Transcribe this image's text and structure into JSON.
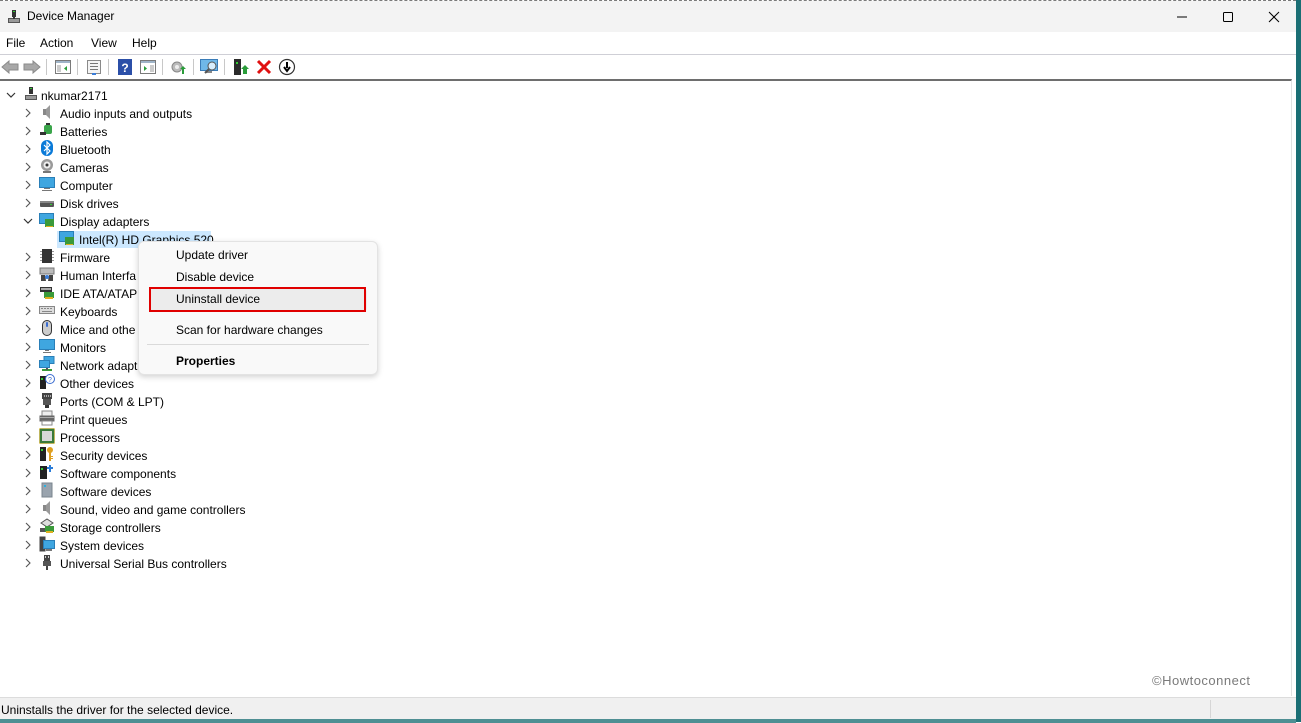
{
  "window": {
    "title": "Device Manager",
    "controls": {
      "minimize": "minimize",
      "maximize": "maximize",
      "close": "close"
    },
    "accent_edge_color": "#1a6e74"
  },
  "menubar": {
    "items": [
      {
        "label": "File"
      },
      {
        "label": "Action"
      },
      {
        "label": "View"
      },
      {
        "label": "Help"
      }
    ]
  },
  "toolbar": {
    "buttons": [
      {
        "icon": "back-arrow-icon",
        "enabled": false
      },
      {
        "icon": "forward-arrow-icon",
        "enabled": false
      },
      {
        "icon": "show-hide-console-tree-icon"
      },
      {
        "icon": "properties-icon"
      },
      {
        "icon": "help-icon"
      },
      {
        "icon": "show-hide-action-pane-icon"
      },
      {
        "icon": "update-driver-icon"
      },
      {
        "icon": "scan-hardware-changes-icon"
      },
      {
        "icon": "add-legacy-hardware-icon"
      },
      {
        "icon": "uninstall-device-icon"
      },
      {
        "icon": "disable-device-icon"
      }
    ]
  },
  "tree": {
    "root": {
      "label": "nkumar2171",
      "expanded": true
    },
    "categories": [
      {
        "label": "Audio inputs and outputs",
        "icon": "speaker-icon",
        "expanded": false
      },
      {
        "label": "Batteries",
        "icon": "battery-icon",
        "expanded": false
      },
      {
        "label": "Bluetooth",
        "icon": "bluetooth-icon",
        "expanded": false
      },
      {
        "label": "Cameras",
        "icon": "camera-icon",
        "expanded": false
      },
      {
        "label": "Computer",
        "icon": "computer-icon",
        "expanded": false
      },
      {
        "label": "Disk drives",
        "icon": "disk-drive-icon",
        "expanded": false
      },
      {
        "label": "Display adapters",
        "icon": "display-adapter-icon",
        "expanded": true,
        "children": [
          {
            "label": "Intel(R) HD Graphics 520",
            "selected": true
          }
        ]
      },
      {
        "label": "Firmware",
        "icon": "firmware-chip-icon",
        "expanded": false
      },
      {
        "label": "Human Interface Devices",
        "display": "Human Interfa",
        "icon": "hid-icon",
        "expanded": false
      },
      {
        "label": "IDE ATA/ATAPI controllers",
        "display": "IDE ATA/ATAPI",
        "icon": "ide-controller-icon",
        "expanded": false
      },
      {
        "label": "Keyboards",
        "icon": "keyboard-icon",
        "expanded": false
      },
      {
        "label": "Mice and other pointing devices",
        "display": "Mice and othe",
        "icon": "mouse-icon",
        "expanded": false
      },
      {
        "label": "Monitors",
        "icon": "monitor-icon",
        "expanded": false
      },
      {
        "label": "Network adapters",
        "display": "Network adapt",
        "icon": "network-adapter-icon",
        "expanded": false
      },
      {
        "label": "Other devices",
        "icon": "other-devices-icon",
        "expanded": false
      },
      {
        "label": "Ports (COM & LPT)",
        "icon": "port-icon",
        "expanded": false
      },
      {
        "label": "Print queues",
        "icon": "printer-icon",
        "expanded": false
      },
      {
        "label": "Processors",
        "icon": "processor-icon",
        "expanded": false
      },
      {
        "label": "Security devices",
        "icon": "security-key-icon",
        "expanded": false
      },
      {
        "label": "Software components",
        "icon": "software-component-icon",
        "expanded": false
      },
      {
        "label": "Software devices",
        "icon": "software-device-icon",
        "expanded": false
      },
      {
        "label": "Sound, video and game controllers",
        "icon": "sound-icon",
        "expanded": false
      },
      {
        "label": "Storage controllers",
        "icon": "storage-controller-icon",
        "expanded": false
      },
      {
        "label": "System devices",
        "icon": "system-devices-icon",
        "expanded": false
      },
      {
        "label": "Universal Serial Bus controllers",
        "icon": "usb-icon",
        "expanded": false
      }
    ]
  },
  "context_menu": {
    "items": [
      {
        "label": "Update driver"
      },
      {
        "label": "Disable device"
      },
      {
        "label": "Uninstall device",
        "highlighted": true,
        "highlight_color": "#e00000"
      },
      {
        "label": "Scan for hardware changes"
      },
      {
        "label": "Properties",
        "bold": true
      }
    ]
  },
  "watermark": "©Howtoconnect",
  "statusbar": {
    "text": "Uninstalls the driver for the selected device."
  }
}
